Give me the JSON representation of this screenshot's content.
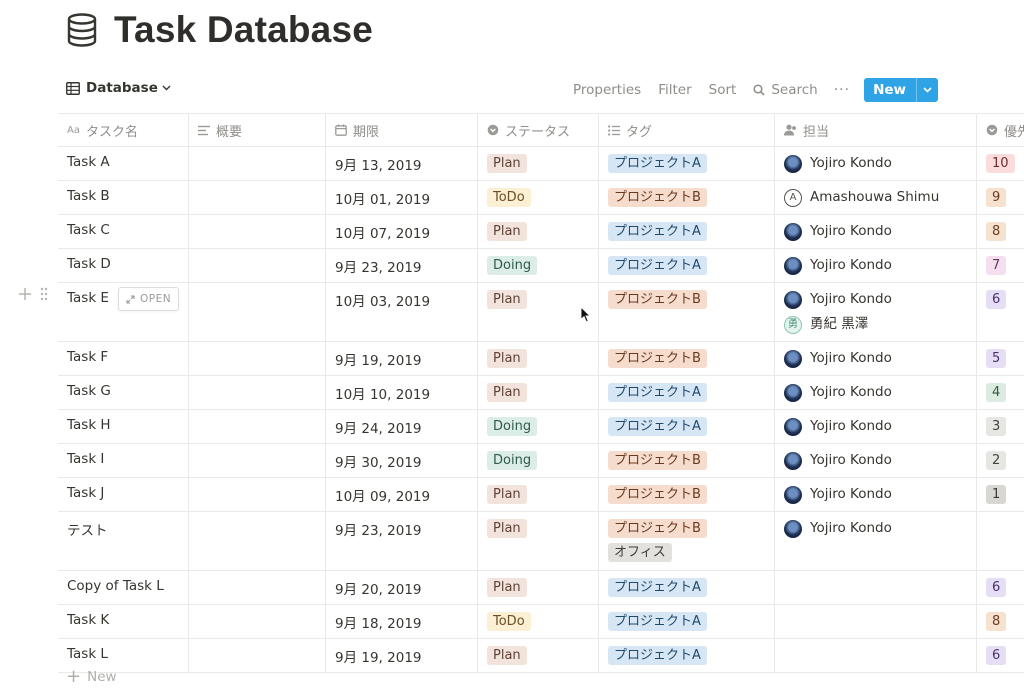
{
  "page": {
    "title": "Task Database",
    "icon": "database-icon"
  },
  "toolbar": {
    "view_label": "Database",
    "properties": "Properties",
    "filter": "Filter",
    "sort": "Sort",
    "search": "Search",
    "more": "···",
    "new": "New",
    "accent": "#2ea4e6"
  },
  "columns": {
    "name": "タスク名",
    "summary": "概要",
    "due": "期限",
    "status": "ステータス",
    "tag": "タグ",
    "assignee": "担当",
    "priority": "優先"
  },
  "rows": [
    {
      "name": "Task A",
      "date": "9月 13, 2019",
      "status": "Plan",
      "tags": [
        "プロジェクトA"
      ],
      "people": [
        "Yojiro Kondo"
      ],
      "priority": "10"
    },
    {
      "name": "Task B",
      "date": "10月 01, 2019",
      "status": "ToDo",
      "tags": [
        "プロジェクトB"
      ],
      "people": [
        "Amashouwa Shimu"
      ],
      "priority": "9"
    },
    {
      "name": "Task C",
      "date": "10月 07, 2019",
      "status": "Plan",
      "tags": [
        "プロジェクトA"
      ],
      "people": [
        "Yojiro Kondo"
      ],
      "priority": "8"
    },
    {
      "name": "Task D",
      "date": "9月 23, 2019",
      "status": "Doing",
      "tags": [
        "プロジェクトA"
      ],
      "people": [
        "Yojiro Kondo"
      ],
      "priority": "7"
    },
    {
      "name": "Task E",
      "date": "10月 03, 2019",
      "status": "Plan",
      "tags": [
        "プロジェクトB"
      ],
      "people": [
        "Yojiro Kondo",
        "勇紀 黒澤"
      ],
      "priority": "6"
    },
    {
      "name": "Task F",
      "date": "9月 19, 2019",
      "status": "Plan",
      "tags": [
        "プロジェクトB"
      ],
      "people": [
        "Yojiro Kondo"
      ],
      "priority": "5"
    },
    {
      "name": "Task G",
      "date": "10月 10, 2019",
      "status": "Plan",
      "tags": [
        "プロジェクトA"
      ],
      "people": [
        "Yojiro Kondo"
      ],
      "priority": "4"
    },
    {
      "name": "Task H",
      "date": "9月 24, 2019",
      "status": "Doing",
      "tags": [
        "プロジェクトA"
      ],
      "people": [
        "Yojiro Kondo"
      ],
      "priority": "3"
    },
    {
      "name": "Task I",
      "date": "9月 30, 2019",
      "status": "Doing",
      "tags": [
        "プロジェクトB"
      ],
      "people": [
        "Yojiro Kondo"
      ],
      "priority": "2"
    },
    {
      "name": "Task J",
      "date": "10月 09, 2019",
      "status": "Plan",
      "tags": [
        "プロジェクトB"
      ],
      "people": [
        "Yojiro Kondo"
      ],
      "priority": "1"
    },
    {
      "name": "テスト",
      "date": "9月 23, 2019",
      "status": "Plan",
      "tags": [
        "プロジェクトB",
        "オフィス"
      ],
      "people": [
        "Yojiro Kondo"
      ],
      "priority": ""
    },
    {
      "name": "Copy of Task L",
      "date": "9月 20, 2019",
      "status": "Plan",
      "tags": [
        "プロジェクトA"
      ],
      "people": [],
      "priority": "6"
    },
    {
      "name": "Task K",
      "date": "9月 18, 2019",
      "status": "ToDo",
      "tags": [
        "プロジェクトA"
      ],
      "people": [],
      "priority": "8"
    },
    {
      "name": "Task L",
      "date": "9月 19, 2019",
      "status": "Plan",
      "tags": [
        "プロジェクトA"
      ],
      "people": [],
      "priority": "6"
    }
  ],
  "row_hover": {
    "open_label": "OPEN"
  },
  "footer": {
    "new_row": "New"
  },
  "people_letters": {
    "Amashouwa Shimu": "A",
    "勇紀 黒澤": "勇"
  },
  "status_colors": {
    "Plan": "#f2e4dd",
    "ToDo": "#fbefd4",
    "Doing": "#dcece7"
  },
  "tag_colors": {
    "プロジェクトA": "#d7e6f4",
    "プロジェクトB": "#f6dccd",
    "オフィス": "#e2e1dd"
  }
}
